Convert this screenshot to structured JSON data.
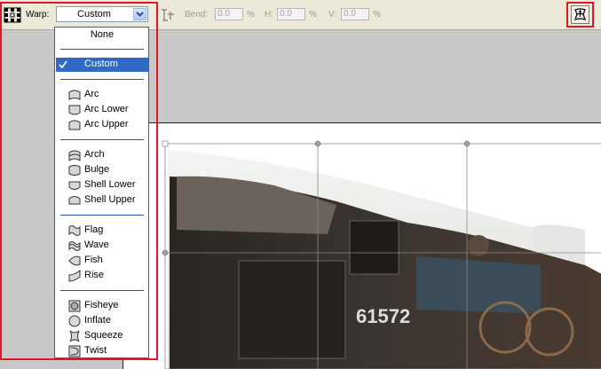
{
  "toolbar": {
    "warp_label": "Warp:",
    "warp_value": "Custom",
    "bend_label": "Bend:",
    "bend_value": "0.0",
    "h_label": "H:",
    "h_value": "0.0",
    "v_label": "V:",
    "v_value": "0.0",
    "percent": "%",
    "grid_icon": "warp-grid-icon",
    "anchor_icon": "orientation-icon",
    "mode_icon": "warp-mode-icon"
  },
  "menu": {
    "none": "None",
    "custom": "Custom",
    "arc": "Arc",
    "arc_lower": "Arc Lower",
    "arc_upper": "Arc Upper",
    "arch": "Arch",
    "bulge": "Bulge",
    "shell_lower": "Shell Lower",
    "shell_upper": "Shell Upper",
    "flag": "Flag",
    "wave": "Wave",
    "fish": "Fish",
    "rise": "Rise",
    "fisheye": "Fisheye",
    "inflate": "Inflate",
    "squeeze": "Squeeze",
    "twist": "Twist"
  },
  "image": {
    "locomotive_number": "61572"
  },
  "colors": {
    "highlight": "#e0162b",
    "selection": "#316ac5"
  }
}
